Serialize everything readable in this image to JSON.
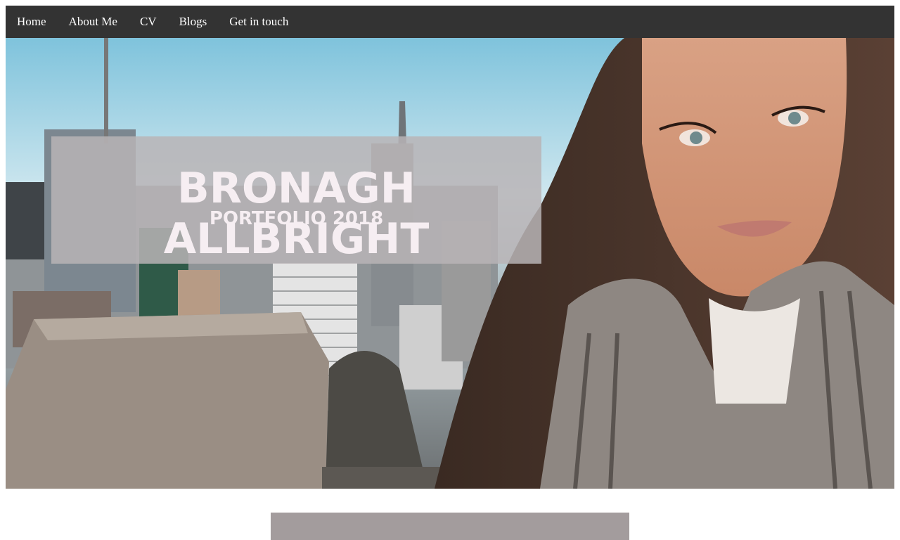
{
  "nav": {
    "items": [
      {
        "label": "Home"
      },
      {
        "label": "About Me"
      },
      {
        "label": "CV"
      },
      {
        "label": "Blogs"
      },
      {
        "label": "Get in touch"
      }
    ]
  },
  "hero": {
    "title": "BRONAGH ALLBRIGHT",
    "subtitle": "PORTFOLIO 2018"
  },
  "colors": {
    "nav_background": "#333333",
    "nav_text": "#ffffff",
    "title_box": "#b8b4b6",
    "section_bar": "#a39c9d"
  }
}
